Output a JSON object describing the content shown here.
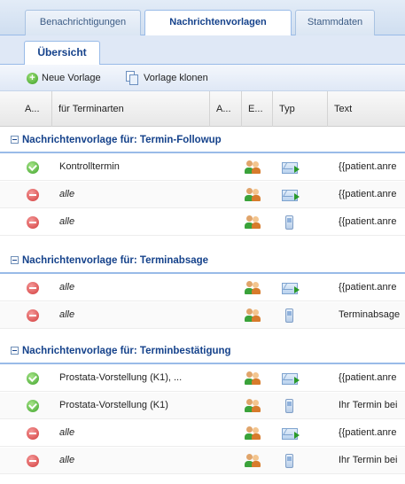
{
  "top_tabs": [
    {
      "label": "Benachrichtigungen",
      "active": false
    },
    {
      "label": "Nachrichtenvorlagen",
      "active": true
    },
    {
      "label": "Stammdaten",
      "active": false
    }
  ],
  "sub_tab": {
    "label": "Übersicht"
  },
  "toolbar": {
    "new_template": "Neue Vorlage",
    "clone_template": "Vorlage klonen"
  },
  "grid_headers": [
    "A...",
    "für Terminarten",
    "A...",
    "E...",
    "Typ",
    "Text"
  ],
  "groups": [
    {
      "title": "Nachrichtenvorlage für: Termin-Followup",
      "rows": [
        {
          "status": "active",
          "appointment_types": "Kontrolltermin",
          "italic": false,
          "type": "email",
          "text": "{{patient.anre"
        },
        {
          "status": "inactive",
          "appointment_types": "alle",
          "italic": true,
          "type": "email",
          "text": "{{patient.anre"
        },
        {
          "status": "inactive",
          "appointment_types": "alle",
          "italic": true,
          "type": "sms",
          "text": "{{patient.anre"
        }
      ]
    },
    {
      "title": "Nachrichtenvorlage für: Terminabsage",
      "rows": [
        {
          "status": "inactive",
          "appointment_types": "alle",
          "italic": true,
          "type": "email",
          "text": "{{patient.anre"
        },
        {
          "status": "inactive",
          "appointment_types": "alle",
          "italic": true,
          "type": "sms",
          "text": "Terminabsage"
        }
      ]
    },
    {
      "title": "Nachrichtenvorlage für: Terminbestätigung",
      "rows": [
        {
          "status": "active",
          "appointment_types": "Prostata-Vorstellung (K1), ...",
          "italic": false,
          "type": "email",
          "text": "{{patient.anre"
        },
        {
          "status": "active",
          "appointment_types": "Prostata-Vorstellung (K1)",
          "italic": false,
          "type": "sms",
          "text": "Ihr Termin bei"
        },
        {
          "status": "inactive",
          "appointment_types": "alle",
          "italic": true,
          "type": "email",
          "text": "{{patient.anre"
        },
        {
          "status": "inactive",
          "appointment_types": "alle",
          "italic": true,
          "type": "sms",
          "text": "Ihr Termin bei"
        }
      ]
    }
  ],
  "colors": {
    "group_title": "#15428b",
    "status_active": "#3ea32a",
    "status_inactive": "#d23a3a",
    "accent_border": "#99bbe8"
  }
}
